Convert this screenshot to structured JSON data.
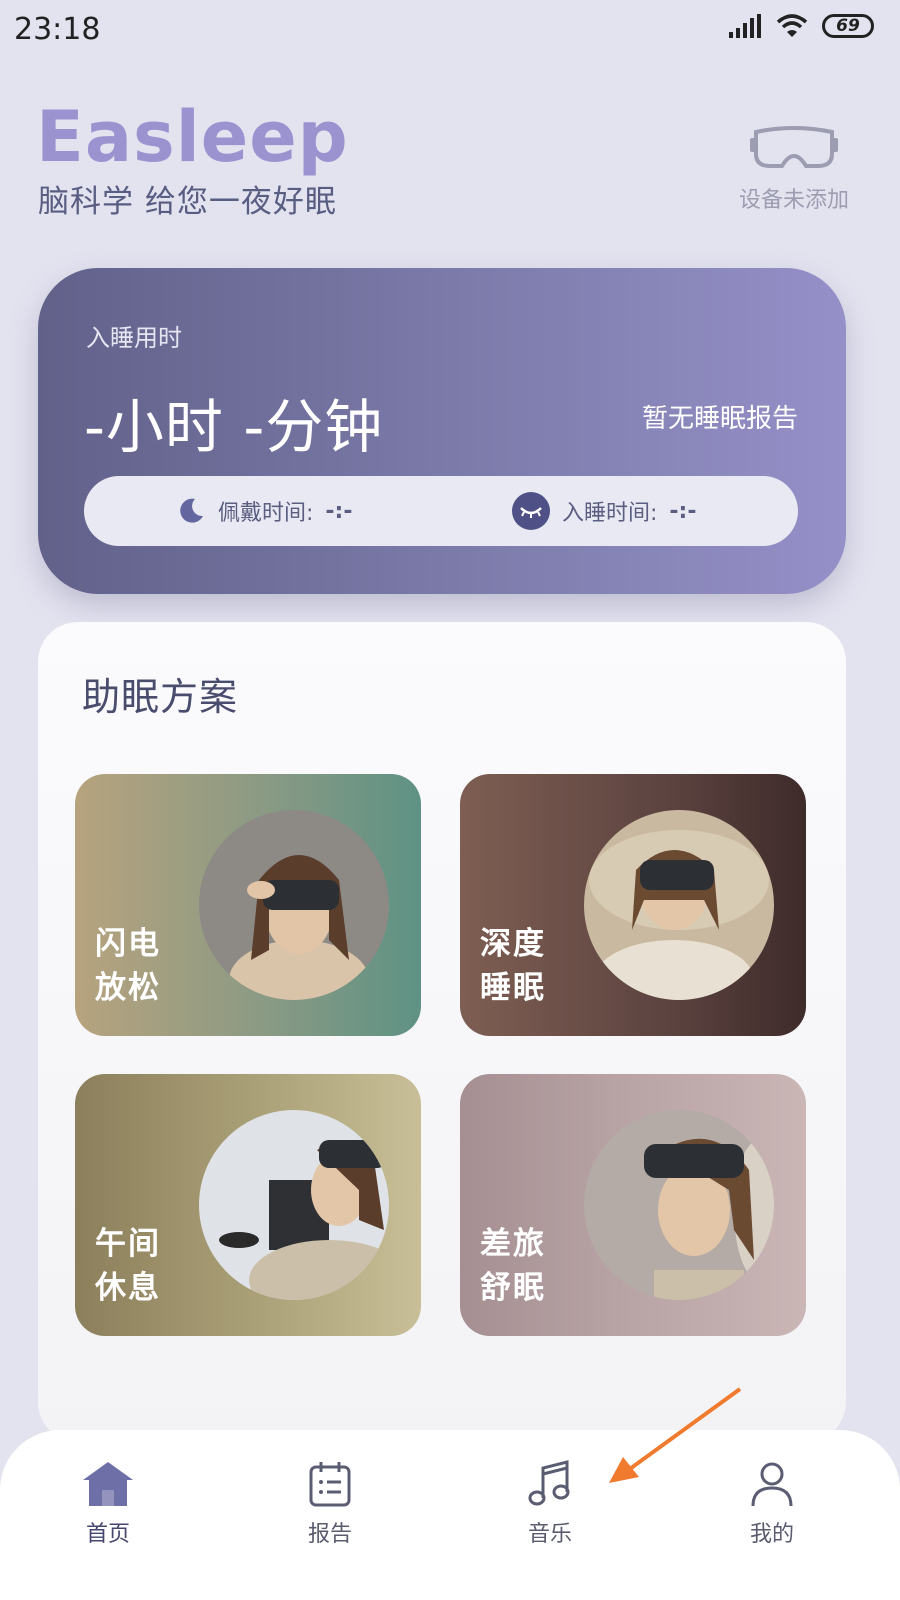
{
  "status_bar": {
    "time": "23:18",
    "battery": "69"
  },
  "brand": {
    "logo": "Easleep",
    "slogan": "脑科学 给您一夜好眠"
  },
  "device": {
    "label": "设备未添加"
  },
  "sleep_card": {
    "label": "入睡用时",
    "value": "-小时 -分钟",
    "no_report": "暂无睡眠报告",
    "wear_time": {
      "label": "佩戴时间:",
      "value": "-:-"
    },
    "fall_asleep_time": {
      "label": "入睡时间:",
      "value": "-:-"
    }
  },
  "plans": {
    "title": "助眠方案",
    "items": [
      {
        "line1": "闪电",
        "line2": "放松",
        "bg": "linear-gradient(90deg,#b7a37e 0%,#8a9a84 55%,#5e9284 100%)"
      },
      {
        "line1": "深度",
        "line2": "睡眠",
        "bg": "linear-gradient(90deg,#7e5e52 0%,#5c4340 60%,#3e2b2a 100%)"
      },
      {
        "line1": "午间",
        "line2": "休息",
        "bg": "linear-gradient(90deg,#8c7f5c 0%,#a99f76 50%,#c8bf98 100%)"
      },
      {
        "line1": "差旅",
        "line2": "舒眠",
        "bg": "linear-gradient(90deg,#a58f92 0%,#b9a4a6 50%,#cbb6b6 100%)"
      }
    ]
  },
  "nav": {
    "items": [
      {
        "label": "首页",
        "icon": "home-icon",
        "active": true
      },
      {
        "label": "报告",
        "icon": "calendar-icon",
        "active": false
      },
      {
        "label": "音乐",
        "icon": "music-icon",
        "active": false
      },
      {
        "label": "我的",
        "icon": "user-icon",
        "active": false
      }
    ]
  },
  "colors": {
    "accent": "#6f6fa8",
    "background": "#e3e3f0",
    "arrow": "#f07a2e"
  }
}
